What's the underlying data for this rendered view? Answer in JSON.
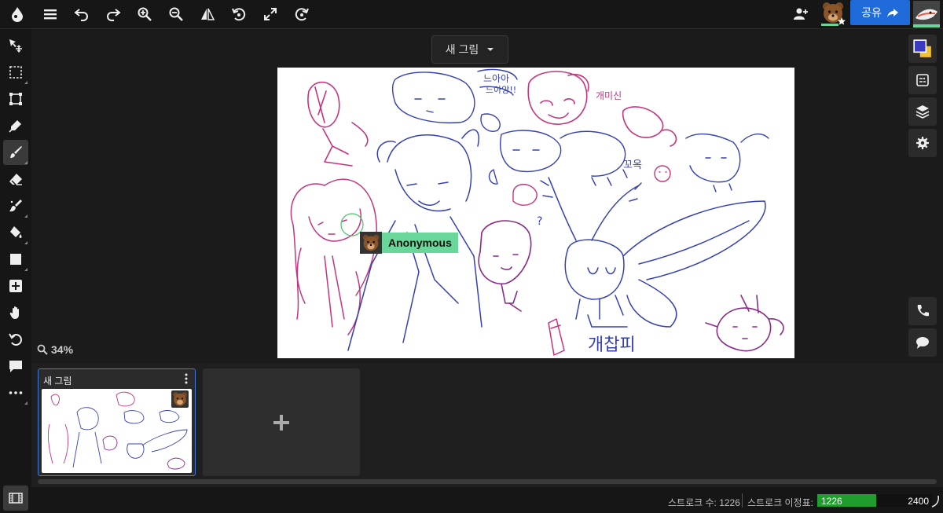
{
  "topbar": {
    "share_label": "공유",
    "icons": [
      "app-logo-icon",
      "menu-icon",
      "undo-icon",
      "redo-icon",
      "zoom-in-icon",
      "zoom-out-icon",
      "flip-icon",
      "rotate-left-icon",
      "fullscreen-icon",
      "rotate-right-icon",
      "add-user-icon",
      "user-avatar-icon",
      "share-icon"
    ]
  },
  "document": {
    "title": "새 그림"
  },
  "tools": [
    "select-move-icon",
    "marquee-icon",
    "transform-icon",
    "pen-icon",
    "brush-icon",
    "eraser-icon",
    "smudge-icon",
    "fill-icon",
    "shape-icon",
    "add-layer-icon",
    "hand-icon",
    "rotate-icon",
    "comment-icon",
    "more-icon"
  ],
  "right_panel": [
    "color-swatch-icon",
    "reference-icon",
    "layers-icon",
    "settings-icon",
    "call-icon",
    "chat-icon"
  ],
  "colors": {
    "primary": "#3b3bbf",
    "secondary": "#f2c230",
    "accent": "#1f6bd9",
    "user_tag": "#6bd69a",
    "meter_fill": "#1f9d2d"
  },
  "cursor_user": {
    "name": "Anonymous"
  },
  "canvas": {
    "zoom": "34%"
  },
  "frames": [
    {
      "title": "새 그림"
    }
  ],
  "status": {
    "stroke_count_label": "스트로크 수: 1226",
    "stroke_meter_label": "스트로크 이정표:",
    "meter_value": "1226",
    "meter_max": "2400",
    "meter_fraction": 0.5108
  }
}
